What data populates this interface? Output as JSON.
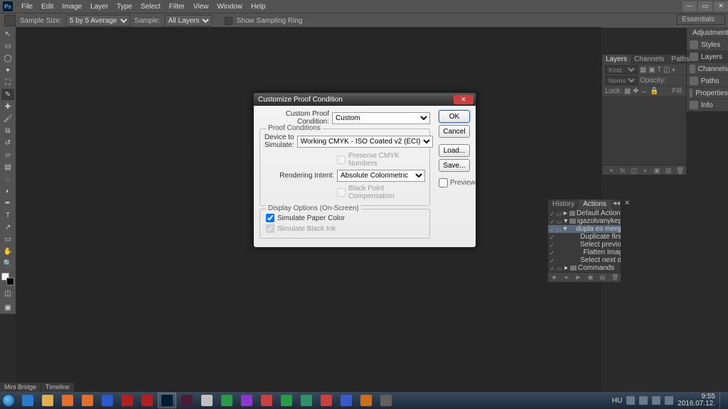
{
  "menubar": {
    "items": [
      "File",
      "Edit",
      "Image",
      "Layer",
      "Type",
      "Select",
      "Filter",
      "View",
      "Window",
      "Help"
    ]
  },
  "optbar": {
    "label_sample_size": "Sample Size:",
    "sample_size_value": "5 by 5 Average",
    "label_sample": "Sample:",
    "sample_value": "All Layers",
    "show_sampling_ring": "Show Sampling Ring"
  },
  "workspace_switcher": "Essentials",
  "right_panels": [
    "Adjustments",
    "Styles",
    "Layers",
    "Channels",
    "Paths",
    "Properties",
    "Info"
  ],
  "right_panel_selected": "Layers",
  "layers_panel": {
    "tabs": [
      "Layers",
      "Channels",
      "Paths"
    ],
    "kind_label": "Kind",
    "blend": "Normal",
    "opacity_label": "Opacity:",
    "lock_label": "Lock:",
    "fill_label": "Fill:"
  },
  "actions_panel": {
    "tabs": [
      "History",
      "Actions"
    ],
    "active_tab": "Actions",
    "rows": [
      {
        "check": true,
        "toggle": true,
        "twisty": "▸",
        "folder": true,
        "label": "Default Actions",
        "sub": false,
        "sel": false
      },
      {
        "check": true,
        "toggle": true,
        "twisty": "▾",
        "folder": true,
        "label": "igazolvanykep",
        "sub": false,
        "sel": false
      },
      {
        "check": true,
        "toggle": true,
        "twisty": "▾",
        "folder": false,
        "label": "dupla es merge",
        "sub": false,
        "sel": true
      },
      {
        "check": true,
        "toggle": false,
        "twisty": "",
        "folder": false,
        "label": "Duplicate first do...",
        "sub": true,
        "sel": false
      },
      {
        "check": true,
        "toggle": false,
        "twisty": "",
        "folder": false,
        "label": "Select previous d...",
        "sub": true,
        "sel": false
      },
      {
        "check": true,
        "toggle": false,
        "twisty": "",
        "folder": false,
        "label": "Flatten Image",
        "sub": true,
        "sel": false
      },
      {
        "check": true,
        "toggle": false,
        "twisty": "",
        "folder": false,
        "label": "Select next docu...",
        "sub": true,
        "sel": false
      },
      {
        "check": true,
        "toggle": true,
        "twisty": "▸",
        "folder": true,
        "label": "Commands",
        "sub": false,
        "sel": false
      }
    ]
  },
  "bottom_tabs": [
    "Mini Bridge",
    "Timeline"
  ],
  "dialog": {
    "title": "Customize Proof Condition",
    "custom_proof_label": "Custom Proof Condition:",
    "custom_proof_value": "Custom",
    "fs1_legend": "Proof Conditions",
    "device_label": "Device to Simulate:",
    "device_value": "Working CMYK - ISO Coated v2 (ECI)",
    "preserve_cmyk": "Preserve CMYK Numbers",
    "rendering_label": "Rendering Intent:",
    "rendering_value": "Absolute Colorimetric",
    "bpc": "Black Point Compensation",
    "fs2_legend": "Display Options (On-Screen)",
    "sim_paper": "Simulate Paper Color",
    "sim_black": "Simulate Black Ink",
    "btn_ok": "OK",
    "btn_cancel": "Cancel",
    "btn_load": "Load...",
    "btn_save": "Save...",
    "preview": "Preview"
  },
  "taskbar": {
    "lang": "HU",
    "time": "9:55",
    "date": "2016.07.12.",
    "icons": [
      {
        "name": "internet-explorer",
        "bg": "#2a7acc"
      },
      {
        "name": "file-explorer",
        "bg": "#e0b050"
      },
      {
        "name": "media-player",
        "bg": "#e07030"
      },
      {
        "name": "firefox",
        "bg": "#e07030"
      },
      {
        "name": "word",
        "bg": "#2a5acc"
      },
      {
        "name": "adobe-reader",
        "bg": "#b02020"
      },
      {
        "name": "acrobat",
        "bg": "#b02020"
      },
      {
        "name": "photoshop",
        "bg": "#001c33"
      },
      {
        "name": "indesign",
        "bg": "#4a1c33"
      },
      {
        "name": "totalcmd",
        "bg": "#c0c0c0"
      },
      {
        "name": "app1",
        "bg": "#2a9a4a"
      },
      {
        "name": "app2",
        "bg": "#8a3aca"
      },
      {
        "name": "app3",
        "bg": "#c84040"
      },
      {
        "name": "excel",
        "bg": "#2a9a4a"
      },
      {
        "name": "corel",
        "bg": "#30906a"
      },
      {
        "name": "app4",
        "bg": "#c84040"
      },
      {
        "name": "app5",
        "bg": "#3a5aca"
      },
      {
        "name": "illustrator",
        "bg": "#c87020"
      },
      {
        "name": "app6",
        "bg": "#606060"
      }
    ]
  }
}
